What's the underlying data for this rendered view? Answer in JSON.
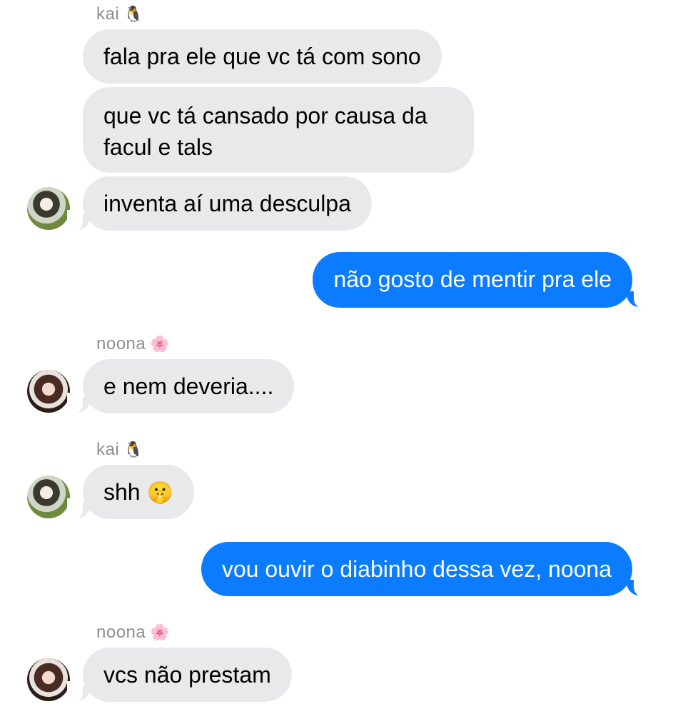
{
  "conversation": [
    {
      "type": "sender",
      "name": "kai",
      "emoji": "🐧"
    },
    {
      "type": "incoming",
      "text": "fala pra ele que vc tá com sono"
    },
    {
      "type": "incoming",
      "text": "que vc tá cansado por causa da facul e tals"
    },
    {
      "type": "incoming",
      "text": "inventa aí uma desculpa",
      "avatar": "kai-avatar"
    },
    {
      "type": "outgoing",
      "text": "não gosto de mentir pra ele"
    },
    {
      "type": "sender",
      "name": "noona",
      "emoji": "🌸"
    },
    {
      "type": "incoming",
      "text": "e nem deveria....",
      "avatar": "noona-avatar"
    },
    {
      "type": "sender",
      "name": "kai",
      "emoji": "🐧"
    },
    {
      "type": "incoming",
      "text": "shh",
      "emoji": "🤫",
      "avatar": "kai-avatar"
    },
    {
      "type": "outgoing",
      "text": "vou ouvir o diabinho dessa vez, noona"
    },
    {
      "type": "sender",
      "name": "noona",
      "emoji": "🌸"
    },
    {
      "type": "incoming",
      "text": "vcs não prestam",
      "avatar": "noona-avatar"
    }
  ],
  "colors": {
    "incoming_bubble": "#e9e9eb",
    "outgoing_bubble": "#0b7cff",
    "sender_name": "#8e8e93"
  }
}
